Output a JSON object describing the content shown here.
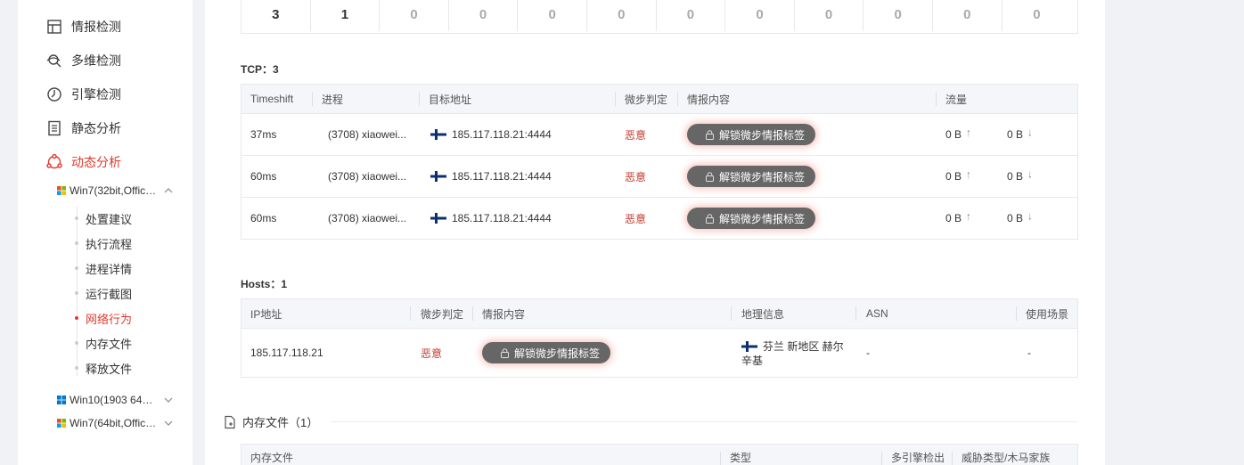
{
  "sidebar": {
    "nav": [
      {
        "label": "情报检测",
        "icon": "layout-icon"
      },
      {
        "label": "多维检测",
        "icon": "multi-search-icon"
      },
      {
        "label": "引擎检测",
        "icon": "engine-icon"
      },
      {
        "label": "静态分析",
        "icon": "document-list-icon"
      },
      {
        "label": "动态分析",
        "icon": "dynamic-analysis-icon",
        "active": true
      }
    ],
    "envs": [
      {
        "label": "Win7(32bit,Office...",
        "expanded": true
      },
      {
        "label": "Win10(1903 64bit...",
        "expanded": false
      },
      {
        "label": "Win7(64bit,Office...",
        "expanded": false
      }
    ],
    "sub_items": [
      "处置建议",
      "执行流程",
      "进程详情",
      "运行截图",
      "网络行为",
      "内存文件",
      "释放文件"
    ],
    "active_sub": "网络行为"
  },
  "counts": [
    "3",
    "1",
    "0",
    "0",
    "0",
    "0",
    "0",
    "0",
    "0",
    "0",
    "0",
    "0"
  ],
  "tcp": {
    "title": "TCP：3",
    "headers": [
      "Timeshift",
      "进程",
      "目标地址",
      "微步判定",
      "情报内容",
      "流量"
    ],
    "rows": [
      {
        "time": "37ms",
        "process": "(3708)  xiaowei...",
        "address": "185.117.118.21:4444",
        "verdict": "恶意",
        "intel": "解锁微步情报标签",
        "up": "0 B",
        "down": "0 B"
      },
      {
        "time": "60ms",
        "process": "(3708)  xiaowei...",
        "address": "185.117.118.21:4444",
        "verdict": "恶意",
        "intel": "解锁微步情报标签",
        "up": "0 B",
        "down": "0 B"
      },
      {
        "time": "60ms",
        "process": "(3708)  xiaowei...",
        "address": "185.117.118.21:4444",
        "verdict": "恶意",
        "intel": "解锁微步情报标签",
        "up": "0 B",
        "down": "0 B"
      }
    ]
  },
  "hosts": {
    "title": "Hosts：1",
    "headers": [
      "IP地址",
      "微步判定",
      "情报内容",
      "地理信息",
      "ASN",
      "使用场景"
    ],
    "rows": [
      {
        "ip": "185.117.118.21",
        "verdict": "恶意",
        "intel": "解锁微步情报标签",
        "geo_line1": "芬兰 新地区 赫尔",
        "geo_line2": "辛基",
        "asn": "-",
        "scene": "-"
      }
    ]
  },
  "memory": {
    "title": "内存文件（1）",
    "headers": [
      "内存文件",
      "类型",
      "多引擎检出",
      "威胁类型/木马家族"
    ]
  },
  "colors": {
    "accent": "#e0392b",
    "malicious": "#c0392b",
    "unlock_bg": "#666666"
  }
}
